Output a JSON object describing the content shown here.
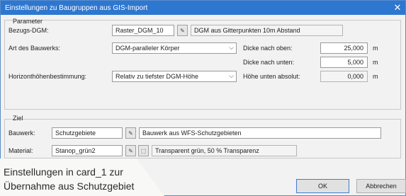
{
  "dialog": {
    "title": "Einstellungen zu Baugruppen aus GIS-Import",
    "close_glyph": "✕"
  },
  "parameter": {
    "group_label": "Parameter",
    "bezugs_dgm_label": "Bezugs-DGM:",
    "bezugs_dgm_value": "Raster_DGM_10",
    "bezugs_dgm_desc": "DGM aus Gitterpunkten 10m Abstand",
    "art_label": "Art des Bauwerks:",
    "art_value": "DGM-paralleler Körper",
    "dicke_oben_label": "Dicke nach oben:",
    "dicke_oben_value": "25,000",
    "dicke_unten_label": "Dicke nach unten:",
    "dicke_unten_value": "5,000",
    "horizont_label": "Horizonthöhenbestimmung:",
    "horizont_value": "Relativ zu tiefster DGM-Höhe",
    "hoehe_label": "Höhe unten absolut:",
    "hoehe_value": "0,000",
    "unit": "m"
  },
  "ziel": {
    "group_label": "Ziel",
    "bauwerk_label": "Bauwerk:",
    "bauwerk_value": "Schutzgebiete",
    "bauwerk_desc": "Bauwerk aus WFS-Schutzgebieten",
    "material_label": "Material:",
    "material_value": "Stanop_grün2",
    "material_desc": "Transparent grün, 50 % Transparenz"
  },
  "buttons": {
    "ok": "OK",
    "cancel": "Abbrechen"
  },
  "caption": {
    "line1": "Einstellungen in card_1 zur",
    "line2": "Übernahme aus Schutzgebiet"
  },
  "icons": {
    "pick": "✎",
    "material": "⬚",
    "dropdown": "⌵"
  },
  "colors": {
    "titlebar": "#2e77d0",
    "dialog_bg": "#f2f2f2",
    "page_bg": "#f0b86a"
  }
}
